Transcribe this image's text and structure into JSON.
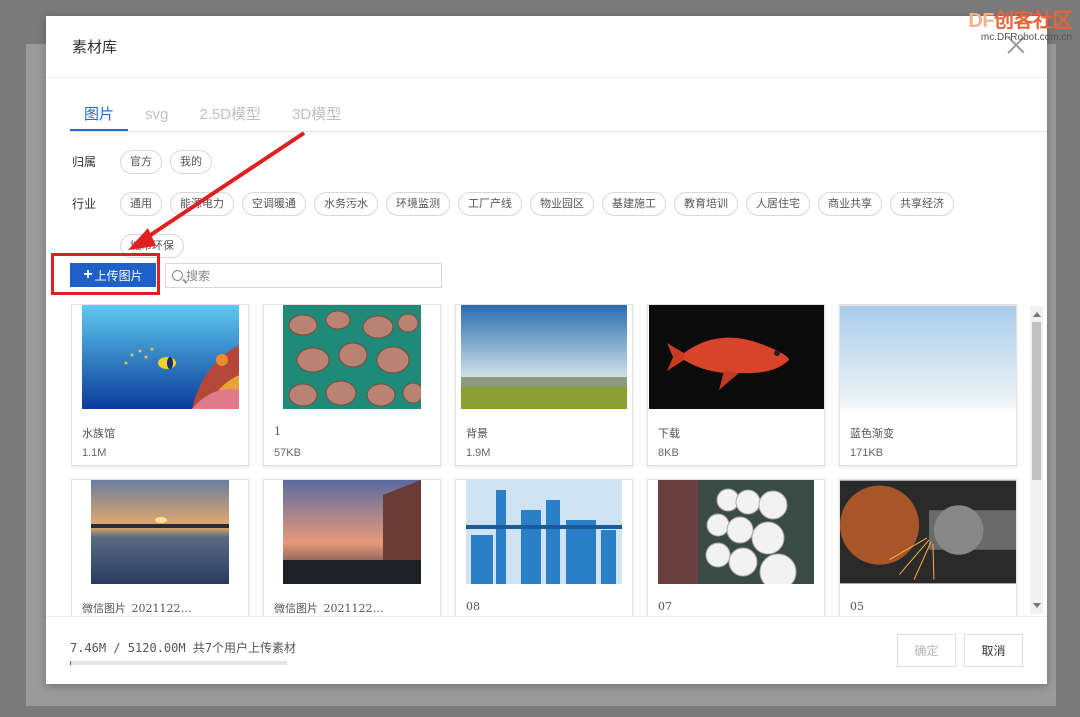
{
  "modal": {
    "title": "素材库"
  },
  "tabs": [
    {
      "label": "图片",
      "active": true
    },
    {
      "label": "svg",
      "active": false
    },
    {
      "label": "2.5D模型",
      "active": false
    },
    {
      "label": "3D模型",
      "active": false
    }
  ],
  "filters": {
    "ownership": {
      "label": "归属",
      "options": [
        "官方",
        "我的"
      ]
    },
    "industry": {
      "label": "行业",
      "options": [
        "通用",
        "能源电力",
        "空调暖通",
        "水务污水",
        "环境监测",
        "工厂产线",
        "物业园区",
        "基建施工",
        "教育培训",
        "人居住宅",
        "商业共享",
        "共享经济",
        "城市环保"
      ]
    }
  },
  "toolbar": {
    "upload_label": "上传图片",
    "search_placeholder": "搜索"
  },
  "assets": [
    {
      "name": "水族馆",
      "size": "1.1M",
      "thumb": "aquarium"
    },
    {
      "name": "1",
      "size": "57KB",
      "thumb": "shells"
    },
    {
      "name": "背景",
      "size": "1.9M",
      "thumb": "field"
    },
    {
      "name": "下载",
      "size": "8KB",
      "thumb": "redfish"
    },
    {
      "name": "蓝色渐变",
      "size": "171KB",
      "thumb": "gradient"
    },
    {
      "name": "微信图片_2021122…",
      "size": "",
      "thumb": "sunset-lake"
    },
    {
      "name": "微信图片_2021122…",
      "size": "",
      "thumb": "sunset-building"
    },
    {
      "name": "08",
      "size": "",
      "thumb": "blue-factory"
    },
    {
      "name": "07",
      "size": "",
      "thumb": "spools"
    },
    {
      "name": "05",
      "size": "",
      "thumb": "grinder"
    }
  ],
  "footer": {
    "usage_text": "7.46M / 5120.00M  共7个用户上传素材",
    "usage_fraction": 0.0015,
    "confirm_label": "确定",
    "cancel_label": "取消"
  },
  "watermark": {
    "logo_a": "DF",
    "logo_b": "创客社区",
    "url": "mc.DFRobot.com.cn"
  },
  "colors": {
    "accent": "#1f6fd1",
    "upload_button": "#1e5fc8",
    "highlight": "#e02020"
  }
}
